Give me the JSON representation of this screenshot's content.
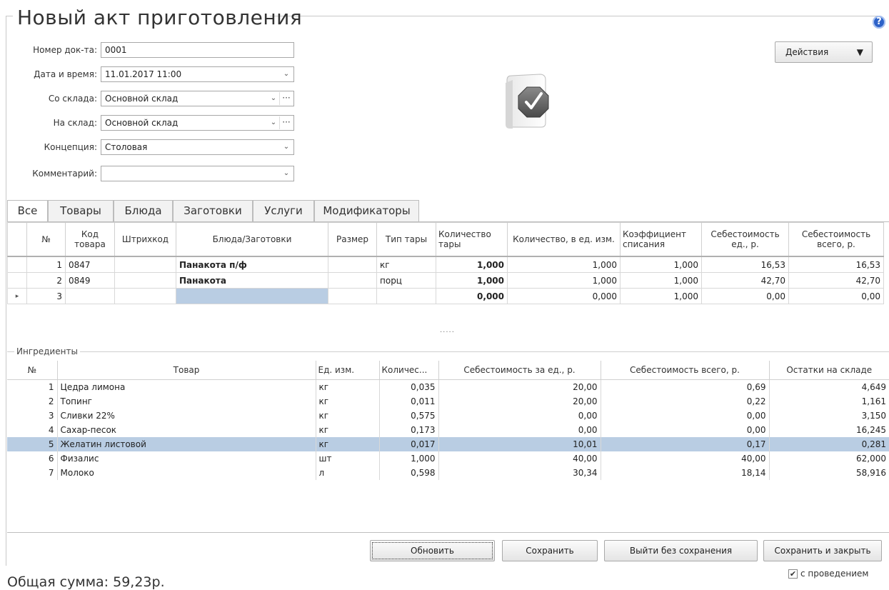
{
  "title": "Новый акт приготовления",
  "help_icon": "?",
  "actions_button": {
    "label": "Действия",
    "arrow": "▼"
  },
  "form": {
    "doc_number": {
      "label": "Номер док-та:",
      "value": "0001"
    },
    "datetime": {
      "label": "Дата и время:",
      "value": "11.01.2017 11:00"
    },
    "from_store": {
      "label": "Со склада:",
      "value": "Основной склад"
    },
    "to_store": {
      "label": "На склад:",
      "value": "Основной склад"
    },
    "concept": {
      "label": "Концепция:",
      "value": "Столовая"
    },
    "comment": {
      "label": "Комментарий:",
      "value": ""
    }
  },
  "tabs": [
    "Все",
    "Товары",
    "Блюда",
    "Заготовки",
    "Услуги",
    "Модификаторы"
  ],
  "dishes_table": {
    "headers": [
      "№",
      "Код товара",
      "Штрихкод",
      "Блюда/Заготовки",
      "Размер",
      "Тип тары",
      "Количество тары",
      "Количество, в ед. изм.",
      "Коэффициент списания",
      "Себестоимость ед., р.",
      "Себестоимость всего, р."
    ],
    "rows": [
      {
        "num": "1",
        "code": "0847",
        "barcode": "",
        "name": "Панакота п/ф",
        "size": "",
        "pack": "кг",
        "pack_qty": "1,000",
        "qty": "1,000",
        "coef": "1,000",
        "unit_cost": "16,53",
        "total_cost": "16,53"
      },
      {
        "num": "2",
        "code": "0849",
        "barcode": "",
        "name": "Панакота",
        "size": "",
        "pack": "порц",
        "pack_qty": "1,000",
        "qty": "1,000",
        "coef": "1,000",
        "unit_cost": "42,70",
        "total_cost": "42,70"
      },
      {
        "num": "3",
        "code": "",
        "barcode": "",
        "name": "",
        "size": "",
        "pack": "",
        "pack_qty": "0,000",
        "qty": "0,000",
        "coef": "1,000",
        "unit_cost": "0,00",
        "total_cost": "0,00"
      }
    ],
    "row_marker": "▸"
  },
  "splitter": "·····",
  "ingredients": {
    "group_label": "Ингредиенты",
    "headers": [
      "№",
      "Товар",
      "Ед. изм.",
      "Количес...",
      "Себестоимость за ед., р.",
      "Себестоимость всего, р.",
      "Остатки на складе"
    ],
    "rows": [
      {
        "num": "1",
        "name": "Цедра лимона",
        "unit": "кг",
        "qty": "0,035",
        "unit_cost": "20,00",
        "total_cost": "0,69",
        "stock": "4,649"
      },
      {
        "num": "2",
        "name": "Топинг",
        "unit": "кг",
        "qty": "0,011",
        "unit_cost": "20,00",
        "total_cost": "0,22",
        "stock": "1,161"
      },
      {
        "num": "3",
        "name": "Сливки 22%",
        "unit": "кг",
        "qty": "0,575",
        "unit_cost": "0,00",
        "total_cost": "0,00",
        "stock": "3,150"
      },
      {
        "num": "4",
        "name": "Сахар-песок",
        "unit": "кг",
        "qty": "0,173",
        "unit_cost": "0,00",
        "total_cost": "0,00",
        "stock": "16,245"
      },
      {
        "num": "5",
        "name": "Желатин листовой",
        "unit": "кг",
        "qty": "0,017",
        "unit_cost": "10,01",
        "total_cost": "0,17",
        "stock": "0,281"
      },
      {
        "num": "6",
        "name": "Физалис",
        "unit": "шт",
        "qty": "1,000",
        "unit_cost": "40,00",
        "total_cost": "40,00",
        "stock": "62,000"
      },
      {
        "num": "7",
        "name": "Молоко",
        "unit": "л",
        "qty": "0,598",
        "unit_cost": "30,34",
        "total_cost": "18,14",
        "stock": "58,916"
      }
    ]
  },
  "buttons": {
    "refresh": "Обновить",
    "save": "Сохранить",
    "exit_no_save": "Выйти без сохранения",
    "save_close": "Сохранить и закрыть"
  },
  "posting_checkbox": {
    "label": "с проведением",
    "checked": true,
    "mark": "✔"
  },
  "total": "Общая сумма: 59,23р.",
  "colors": {
    "selection": "#b9cde3",
    "help_blue": "#2d62c8"
  }
}
